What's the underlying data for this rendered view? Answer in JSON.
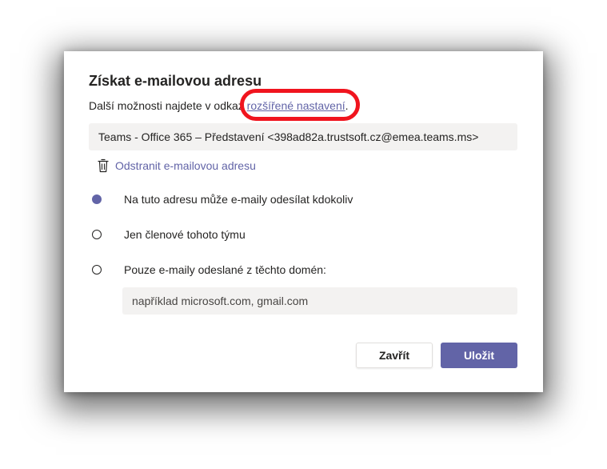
{
  "dialog": {
    "title": "Získat e-mailovou adresu",
    "subline_prefix": "Další možnosti najdete v odkaz",
    "subline_link": "rozšířené nastavení",
    "subline_suffix": ".",
    "email_address": "Teams - Office 365 – Představení <398ad82a.trustsoft.cz@emea.teams.ms>",
    "remove_label": "Odstranit e-mailovou adresu",
    "options": [
      {
        "label": "Na tuto adresu může e-maily odesílat kdokoliv",
        "selected": true
      },
      {
        "label": "Jen členové tohoto týmu",
        "selected": false
      },
      {
        "label": "Pouze e-maily odeslané z těchto domén:",
        "selected": false
      }
    ],
    "domain_placeholder": "například microsoft.com, gmail.com",
    "close_label": "Zavřít",
    "save_label": "Uložit"
  },
  "icons": {
    "trash": "trash-icon",
    "radio": "radio-icon"
  },
  "colors": {
    "accent": "#6264a7",
    "highlight": "#f0141e",
    "field_bg": "#f3f2f1",
    "text": "#252423"
  }
}
